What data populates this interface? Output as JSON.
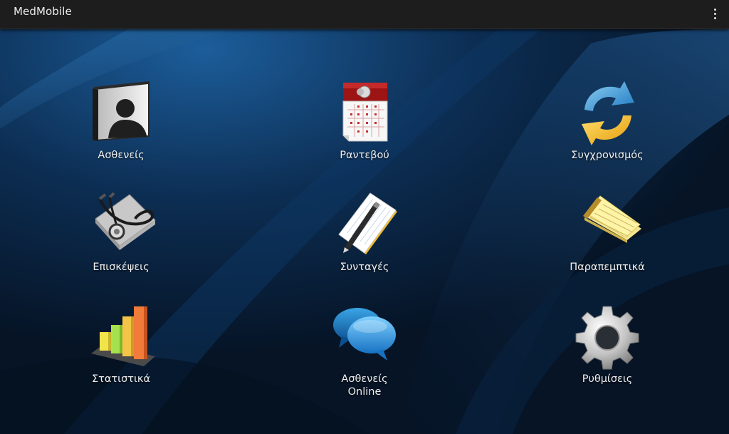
{
  "app": {
    "title": "MedMobile"
  },
  "menu": {
    "overflow_icon": "more-vert-icon"
  },
  "tiles": [
    {
      "id": "patients",
      "label": "Ασθενείς",
      "icon": "patient-folder-icon"
    },
    {
      "id": "appointments",
      "label": "Ραντεβού",
      "icon": "calendar-icon"
    },
    {
      "id": "sync",
      "label": "Συγχρονισμός",
      "icon": "sync-arrows-icon"
    },
    {
      "id": "visits",
      "label": "Επισκέψεις",
      "icon": "stethoscope-icon"
    },
    {
      "id": "prescriptions",
      "label": "Συνταγές",
      "icon": "notepad-pen-icon"
    },
    {
      "id": "referrals",
      "label": "Παραπεμπτικά",
      "icon": "legal-pad-icon"
    },
    {
      "id": "statistics",
      "label": "Στατιστικά",
      "icon": "bar-chart-icon"
    },
    {
      "id": "patients_online",
      "label_line1": "Ασθενείς",
      "label_line2": "Online",
      "icon": "chat-bubbles-icon"
    },
    {
      "id": "settings",
      "label": "Ρυθμίσεις",
      "icon": "gear-icon"
    }
  ],
  "colors": {
    "appbar": "#1d1d1d",
    "background": "#07182b",
    "accent": "#2e7fd0"
  }
}
